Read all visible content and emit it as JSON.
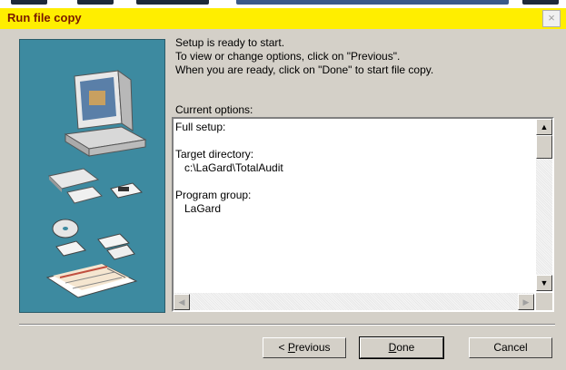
{
  "window": {
    "title": "Run file copy",
    "close_glyph": "×"
  },
  "intro": {
    "line1": "Setup is ready to start.",
    "line2": "To view or change options, click on \"Previous\".",
    "line3": "When you are ready, click on \"Done\" to start file copy."
  },
  "options": {
    "label": "Current options:",
    "lines": [
      "Full setup:",
      "",
      "Target directory:",
      "   c:\\LaGard\\TotalAudit",
      "",
      "Program group:",
      "   LaGard"
    ]
  },
  "buttons": {
    "previous_prefix": "< ",
    "previous_accel": "P",
    "previous_rest": "revious",
    "done_accel": "D",
    "done_rest": "one",
    "cancel": "Cancel"
  },
  "icons": {
    "illustration": "computer-setup-illustration",
    "scroll_up": "scroll-up-arrow-icon",
    "scroll_down": "scroll-down-arrow-icon",
    "scroll_left": "scroll-left-arrow-icon",
    "scroll_right": "scroll-right-arrow-icon"
  },
  "colors": {
    "titlebar": "#ffee00",
    "title_text": "#7a1a00",
    "dialog_face": "#d4d0c8",
    "illustration_bg": "#3d8aa0"
  }
}
